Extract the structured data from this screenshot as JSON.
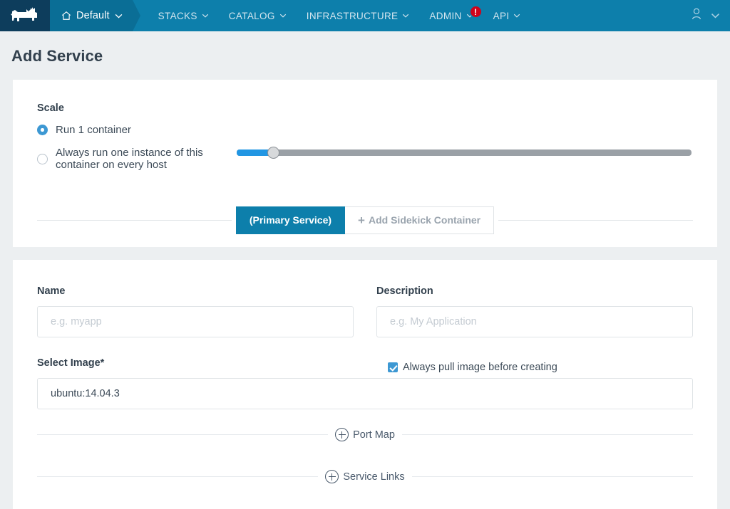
{
  "navbar": {
    "logo_name": "rancher-cow-logo",
    "environment": {
      "label": "Default",
      "icon": "home-icon",
      "caret": "chevron-down-icon"
    },
    "items": [
      {
        "label": "STACKS",
        "caret": true,
        "badge": null
      },
      {
        "label": "CATALOG",
        "caret": true,
        "badge": null
      },
      {
        "label": "INFRASTRUCTURE",
        "caret": true,
        "badge": null
      },
      {
        "label": "ADMIN",
        "caret": true,
        "badge": "!"
      },
      {
        "label": "API",
        "caret": true,
        "badge": null
      }
    ],
    "user_menu": {
      "icon": "user-icon",
      "caret": "chevron-down-icon"
    },
    "colors": {
      "bar": "#0d7fab",
      "logo_bg": "#0d3d5c",
      "env_bg": "#0a6e96",
      "badge": "#d0021b"
    }
  },
  "page": {
    "title": "Add Service"
  },
  "scale": {
    "label": "Scale",
    "options": [
      {
        "label": "Run 1 container",
        "selected": true
      },
      {
        "label": "Always run one instance of this container on every host",
        "selected": false
      }
    ],
    "slider": {
      "value": 1,
      "min": 1,
      "max": 100,
      "fill_percent": 8,
      "accent": "#2196e3",
      "track": "#9aa0a6"
    }
  },
  "tabs": [
    {
      "label": "(Primary Service)",
      "active": true,
      "has_plus": false
    },
    {
      "label": "Add Sidekick Container",
      "active": false,
      "has_plus": true
    }
  ],
  "form": {
    "name": {
      "label": "Name",
      "value": "",
      "placeholder": "e.g. myapp"
    },
    "description": {
      "label": "Description",
      "value": "",
      "placeholder": "e.g. My Application"
    },
    "select_image": {
      "label": "Select Image*",
      "value": "ubuntu:14.04.3",
      "placeholder": ""
    },
    "always_pull": {
      "label": "Always pull image before creating",
      "checked": true,
      "color": "#3d98d3"
    }
  },
  "add_sections": [
    {
      "label": "Port Map",
      "icon": "plus-circle-icon"
    },
    {
      "label": "Service Links",
      "icon": "plus-circle-icon"
    }
  ]
}
